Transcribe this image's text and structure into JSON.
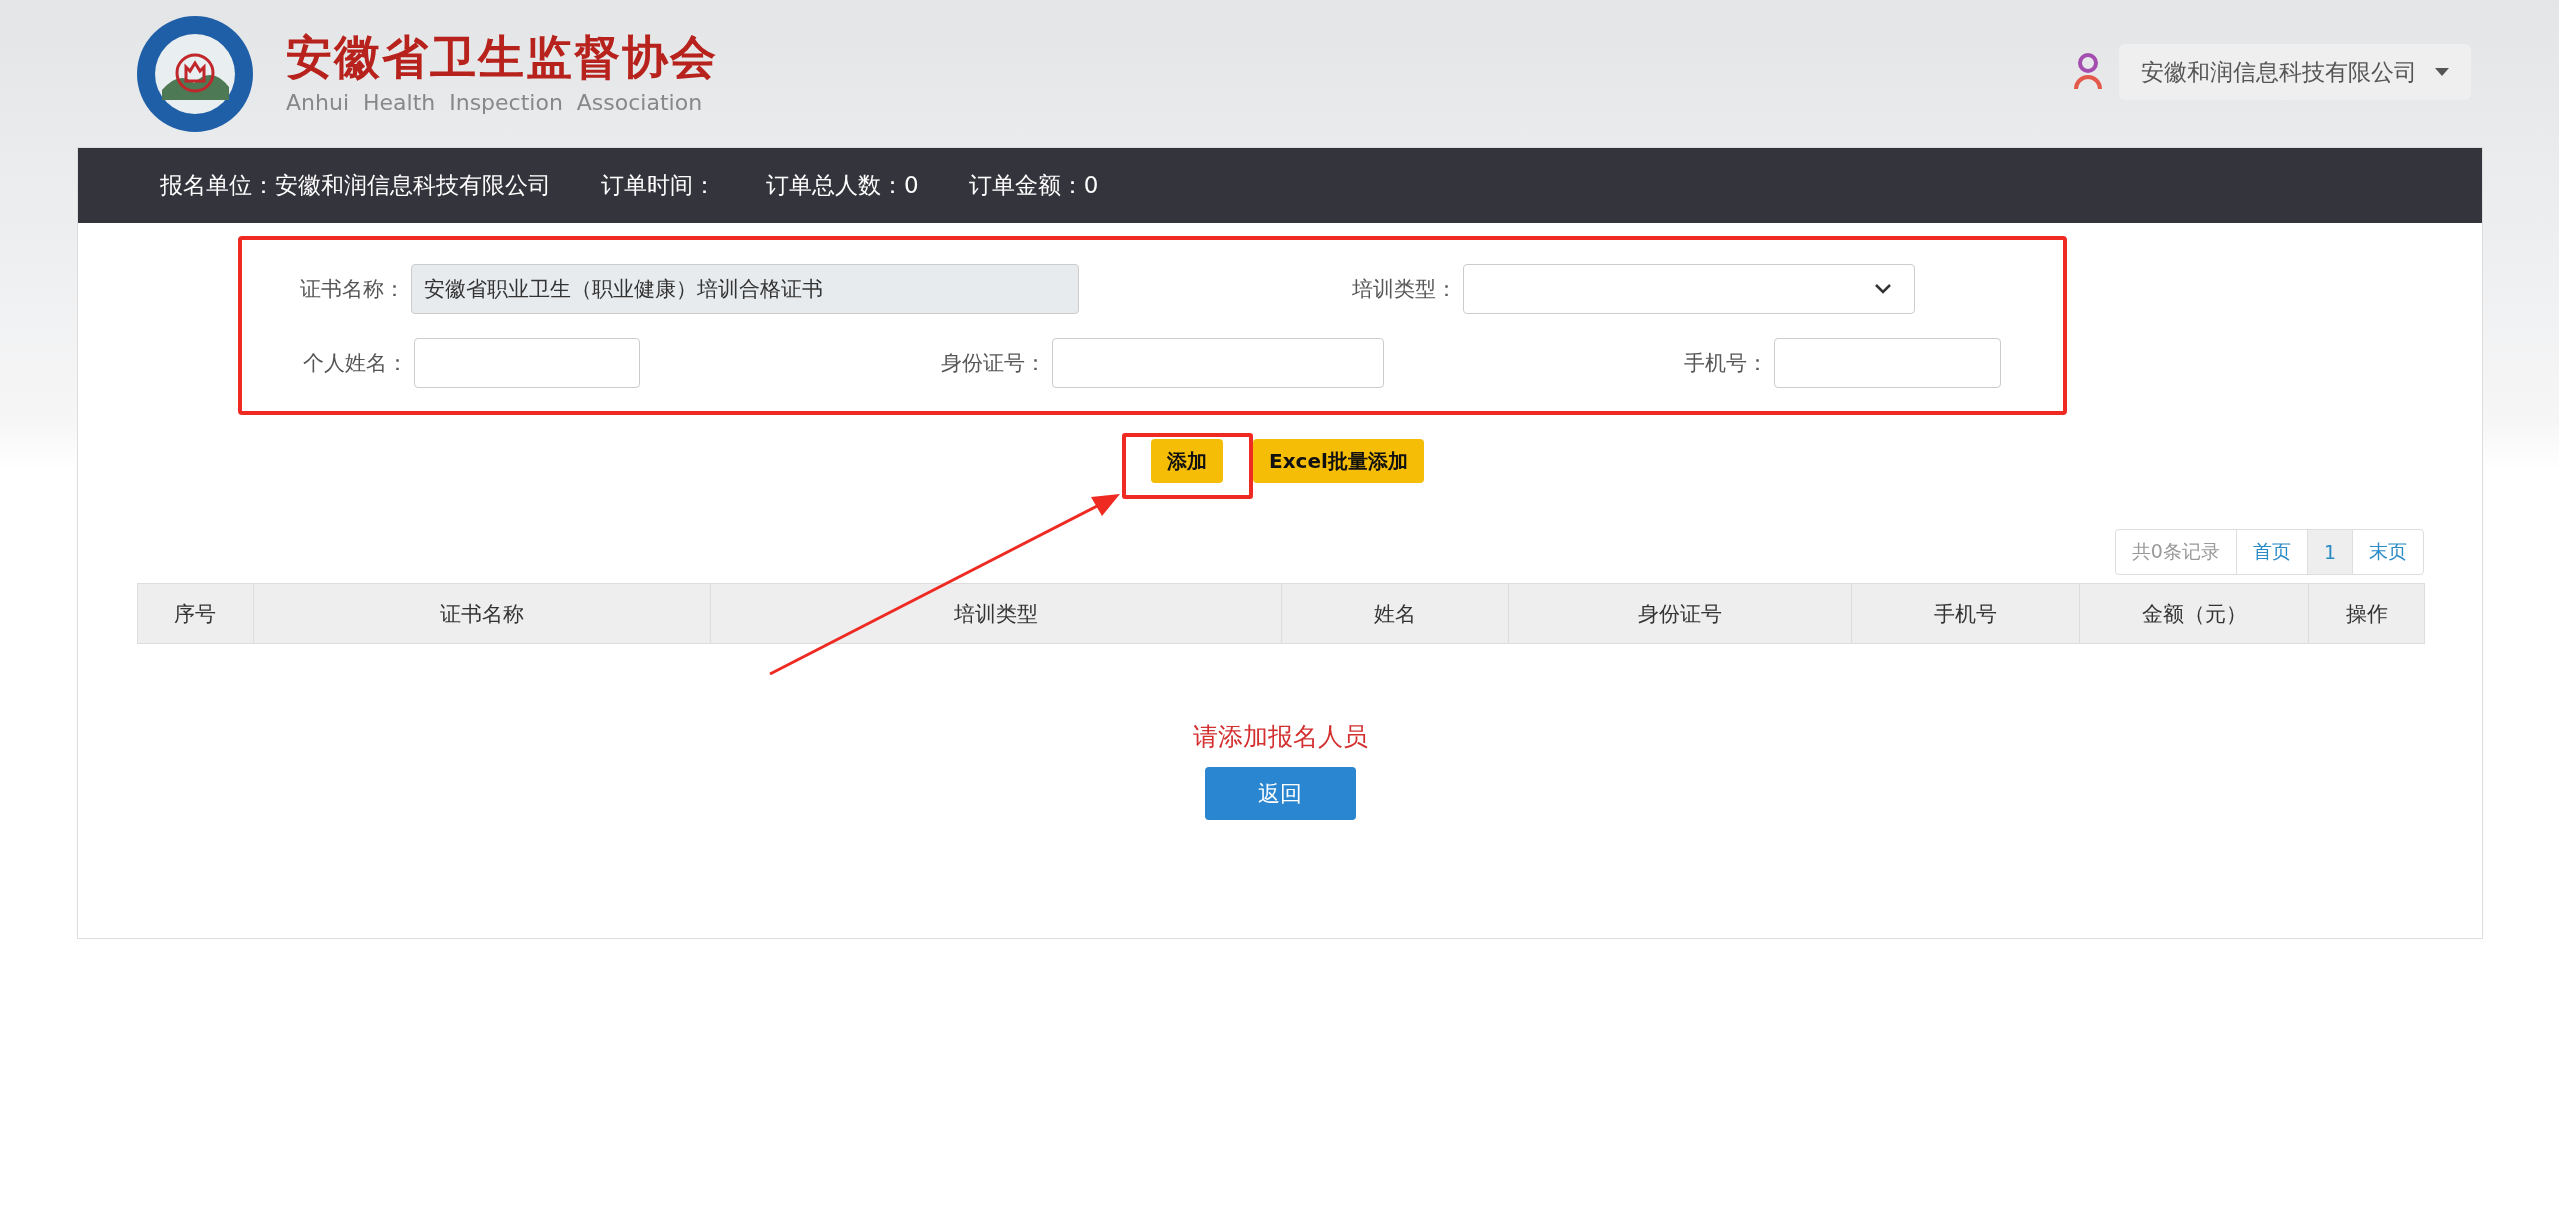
{
  "header": {
    "title": "安徽省卫生监督协会",
    "subtitle": "Anhui  Health  Inspection  Association",
    "user_menu": "安徽和润信息科技有限公司"
  },
  "order_bar": [
    {
      "label": "报名单位：",
      "value": "安徽和润信息科技有限公司"
    },
    {
      "label": "订单时间："
    },
    {
      "label": "订单总人数：",
      "value": "0"
    },
    {
      "label": "订单金额：",
      "value": "0"
    }
  ],
  "form": {
    "certificate": {
      "label": "证书名称：",
      "value": "安徽省职业卫生（职业健康）培训合格证书",
      "disabled": true
    },
    "training_type": {
      "label": "培训类型："
    },
    "fields": [
      {
        "label": "个人姓名："
      },
      {
        "label": "身份证号："
      },
      {
        "label": "手机号："
      }
    ]
  },
  "buttons": [
    "添加",
    "Excel批量添加"
  ],
  "pager": [
    {
      "label": "共0条记录",
      "kind": "info",
      "selected": false
    },
    {
      "label": "首页",
      "kind": "link",
      "selected": false
    },
    {
      "label": "1",
      "kind": "page",
      "selected": true
    },
    {
      "label": "末页",
      "kind": "link",
      "selected": false
    }
  ],
  "table": {
    "columns": [
      "序号",
      "证书名称",
      "培训类型",
      "姓名",
      "身份证号",
      "手机号",
      "金额（元）",
      "操作"
    ]
  },
  "empty_message": "请添加报名人员",
  "back_button": "返回"
}
